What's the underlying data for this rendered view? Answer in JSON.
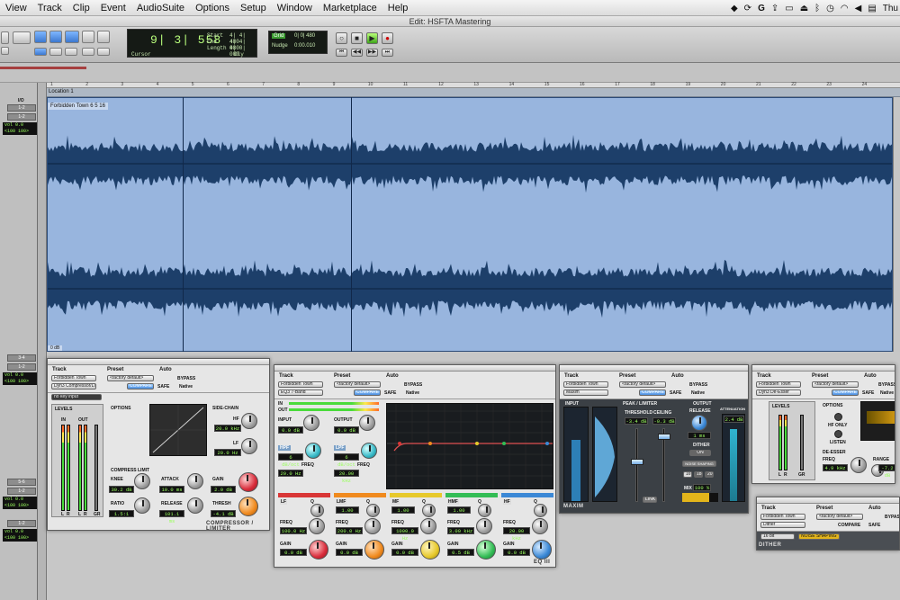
{
  "menubar": {
    "items": [
      "View",
      "Track",
      "Clip",
      "Event",
      "AudioSuite",
      "Options",
      "Setup",
      "Window",
      "Marketplace",
      "Help"
    ],
    "clock": "Thu"
  },
  "window": {
    "title": "Edit: HSFTA Mastering"
  },
  "counter": {
    "main": "9| 3| 558",
    "start_label": "Start",
    "end_label": "End",
    "length_label": "Length",
    "start": "4| 4| 480",
    "end": "4| 4| 480",
    "length": "0| 0| 000",
    "cursor_label": "Cursor",
    "dly_label": "Dly"
  },
  "nudge": {
    "grid_label": "Grid",
    "grid_value": "0| 0| 480",
    "nudge_label": "Nudge",
    "nudge_value": "0:00.010"
  },
  "timeline": {
    "bars": [
      "1",
      "2",
      "3",
      "4",
      "5",
      "6",
      "7",
      "8",
      "9",
      "10",
      "11",
      "12",
      "13",
      "14",
      "15",
      "16",
      "17",
      "18",
      "19",
      "20",
      "21",
      "22",
      "23",
      "24"
    ],
    "marker": "Location 1",
    "clip_name": "Forbidden Town 6 5 16",
    "clip_tag": "0 dB"
  },
  "tracks": [
    {
      "io_label": "I/O",
      "io": "1-2",
      "io2": "1-2",
      "vol_label": "vol",
      "vol": "0.0",
      "pan": "<100  100>"
    },
    {
      "io": "3-4",
      "io2": "1-2",
      "vol_label": "vol",
      "vol": "0.0",
      "pan": "<100  100>"
    },
    {
      "io": "5-6",
      "io2": "1-2",
      "vol_label": "vol",
      "vol": "0.0",
      "pan": "<100  100>"
    },
    {
      "io": "1-2",
      "io2": "",
      "vol_label": "vol",
      "vol": "0.0",
      "pan": "<100  100>"
    }
  ],
  "common": {
    "track_label": "Track",
    "preset_label": "Preset",
    "auto_label": "Auto",
    "track_name": "Forbidden Town",
    "factory": "<factory default>",
    "compare": "COMPARE",
    "bypass": "BYPASS",
    "safe": "SAFE",
    "native": "Native"
  },
  "compressor": {
    "plugin": "Dyn3 Compressor/Limiter",
    "key_input": "no key input",
    "levels": "LEVELS",
    "options": "OPTIONS",
    "side_chain": "SIDE-CHAIN",
    "in": "IN",
    "out": "OUT",
    "meter_labels": [
      "L",
      "R",
      "L",
      "R",
      "GR"
    ],
    "hf_label": "HF",
    "hf_value": "20.0 kHz",
    "lf_label": "LF",
    "lf_value": "20.0 Hz",
    "knee_label": "KNEE",
    "knee": "30.2 dB",
    "attack_label": "ATTACK",
    "attack": "10.0 ms",
    "gain_label": "GAIN",
    "gain": "2.0 dB",
    "ratio_label": "RATIO",
    "ratio": "1.5:1",
    "release_label": "RELEASE",
    "release": "101.1 ms",
    "thresh_label": "THRESH",
    "thresh": "-4.1 dB",
    "compress_limit": "COMPRESS LIMIT",
    "footer": "COMPRESSOR / LIMITER"
  },
  "eq": {
    "plugin": "EQ3 7-Band",
    "in_label": "IN",
    "out_label": "OUT",
    "input_label": "INPUT",
    "input": "0.0 dB",
    "output_label": "OUTPUT",
    "output": "0.0 dB",
    "hpf_label": "HPF",
    "hpf_slope": "6 dB/oct",
    "hpf_freq_label": "FREQ",
    "hpf_freq": "20.0 Hz",
    "lpf_label": "LPF",
    "lpf_slope": "6 dB/oct",
    "lpf_freq_label": "FREQ",
    "lpf_freq": "20.00 kHz",
    "graph_y_ticks": [
      "+18",
      "+12",
      "+6",
      "0",
      "-6",
      "-12",
      "-18"
    ],
    "graph_x_ticks": [
      "32",
      "64",
      "100",
      "250",
      "500",
      "1K",
      "2K",
      "4K",
      "10K",
      "20K"
    ],
    "in_meter_ticks": [
      "-24",
      "-18",
      "-12",
      "-6",
      "-4",
      "-2",
      "0"
    ],
    "bands": [
      {
        "name": "LF",
        "color": "#d93636",
        "q": "Q",
        "freq_label": "FREQ",
        "freq": "100.0 Hz",
        "gain_label": "GAIN",
        "gain": "0.0 dB"
      },
      {
        "name": "LMF",
        "color": "#f08a1e",
        "q": "Q",
        "q_value": "1.00",
        "freq_label": "FREQ",
        "freq": "200.0 Hz",
        "gain_label": "GAIN",
        "gain": "0.0 dB"
      },
      {
        "name": "MF",
        "color": "#e7c92b",
        "q": "Q",
        "q_value": "1.00",
        "freq_label": "FREQ",
        "freq": "1000.0 Hz",
        "gain_label": "GAIN",
        "gain": "0.0 dB"
      },
      {
        "name": "HMF",
        "color": "#33bd55",
        "q": "Q",
        "q_value": "1.00",
        "freq_label": "FREQ",
        "freq": "3.00 kHz",
        "gain_label": "GAIN",
        "gain": "0.5 dB"
      },
      {
        "name": "HF",
        "color": "#3b88d6",
        "q": "Q",
        "freq_label": "FREQ",
        "freq": "20.00 kHz",
        "gain_label": "GAIN",
        "gain": "0.0 dB"
      }
    ],
    "footer": "EQ III"
  },
  "maxim": {
    "plugin": "Maxim",
    "input_label": "INPUT",
    "peak_label": "PEAK / LIMITER",
    "output_label": "OUTPUT",
    "attenuation_label": "ATTENUATION",
    "threshold_label": "THRESHOLD",
    "threshold": "-3.4 dB",
    "ceiling_label": "CEILING",
    "ceiling": "-0.3 dB",
    "release_label": "RELEASE",
    "release": "1 ms",
    "attenuation": "2.4 dB",
    "dither_label": "DITHER",
    "on_label": "ON",
    "noise_shaping": "NOISE SHAPING",
    "bits": [
      "16",
      "18",
      "20"
    ],
    "link_label": "LINK",
    "mix_label": "MIX",
    "mix": "100 %",
    "meter_ticks": [
      "0",
      "-6",
      "-12",
      "-18",
      "-24",
      "-30",
      "-36",
      "-42",
      "-48"
    ],
    "footer": "MAXIM"
  },
  "deesser": {
    "plugin": "Dyn3 De-Esser",
    "levels": "LEVELS",
    "options": "OPTIONS",
    "hf_only": "HF ONLY",
    "listen": "LISTEN",
    "meter_labels": [
      "L",
      "R",
      "GR"
    ],
    "de_esser_label": "DE-ESSER",
    "freq_label": "FREQ",
    "freq": "4.9 kHz",
    "range_label": "RANGE",
    "range": "-7.2 dB"
  },
  "dither": {
    "plugin": "Dither",
    "bits": "16 bit",
    "noise_shaping": "NOISE SHAPING",
    "footer": "DITHER"
  }
}
